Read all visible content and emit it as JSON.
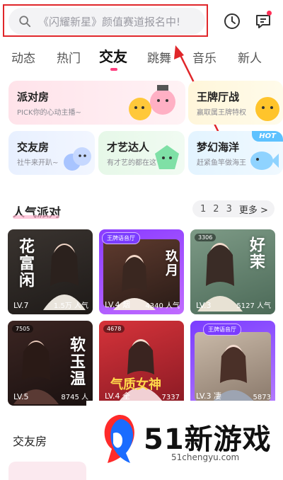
{
  "search": {
    "text": "《闪耀新星》颜值赛道报名中!"
  },
  "tabs": [
    {
      "label": "动态"
    },
    {
      "label": "热门"
    },
    {
      "label": "交友"
    },
    {
      "label": "跳舞"
    },
    {
      "label": "音乐"
    },
    {
      "label": "新人"
    }
  ],
  "active_tab": "交友",
  "cards": {
    "party": {
      "title": "派对房",
      "sub": "PICK你的心动主播~"
    },
    "hall": {
      "title": "王牌厅战",
      "sub": "赢取属王牌特权"
    },
    "friends": {
      "title": "交友房",
      "sub": "社牛来开趴~"
    },
    "talent": {
      "title": "才艺达人",
      "sub": "有才艺的都在这"
    },
    "ocean": {
      "title": "梦幻海洋",
      "sub": "赶紧鱼竿做海王",
      "badge": "HOT"
    }
  },
  "popular_party": {
    "title": "人气派对",
    "pages": [
      "1",
      "2",
      "3"
    ],
    "more": "更多 >",
    "rooms": [
      {
        "level": "LV.7",
        "pop": "1.5万 人气",
        "art": "花富闲"
      },
      {
        "level": "LV.4 烟",
        "pop": "4340 人气",
        "art": "玖月",
        "badge": "王牌语音厅"
      },
      {
        "level": "LV.3",
        "pop": "5127 人气",
        "art": "好茉",
        "id": "3306"
      },
      {
        "level": "LV.5",
        "pop": "8745 人",
        "art": "软玉温",
        "id": "7505"
      },
      {
        "level": "LV.4 全",
        "pop": "7337",
        "art": "气质女神",
        "id": "4678"
      },
      {
        "level": "LV.3 凄",
        "pop": "5873",
        "badge": "王牌语音厅"
      }
    ]
  },
  "friends_section": {
    "title": "交友房"
  },
  "watermark": {
    "text": "51新游戏",
    "url": "51chengyu.com"
  },
  "colors": {
    "accent": "#ff3d7f",
    "highlight": "#e0262a",
    "vip": "#7a3cff"
  }
}
